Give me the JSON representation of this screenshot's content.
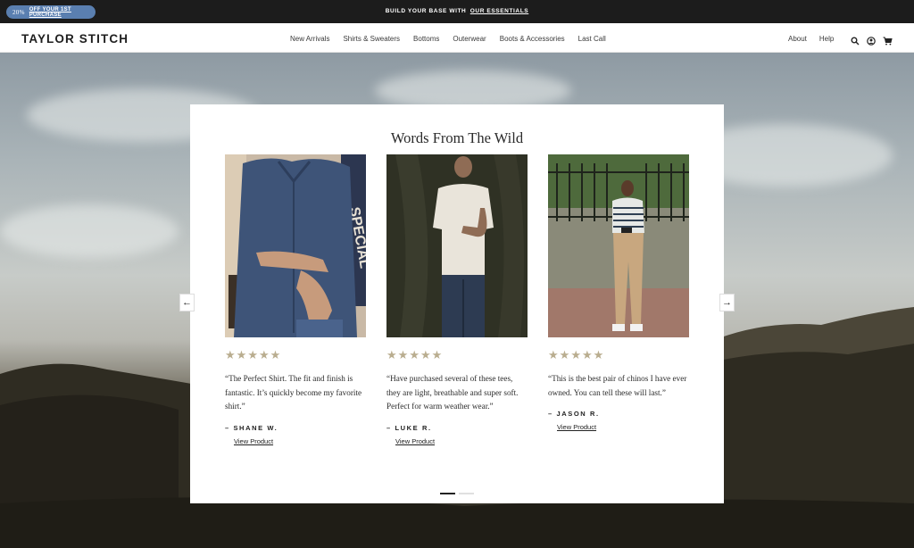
{
  "topbar": {
    "promo_percent": "20%",
    "promo_text": "OFF YOUR 1ST PURCHASE",
    "announcement": "BUILD YOUR BASE WITH",
    "announcement_link": "OUR ESSENTIALS"
  },
  "header": {
    "logo": "TAYLOR STITCH",
    "nav": [
      "New Arrivals",
      "Shirts & Sweaters",
      "Bottoms",
      "Outerwear",
      "Boots & Accessories",
      "Last Call"
    ],
    "utility": [
      "About",
      "Help"
    ],
    "icons": [
      "search-icon",
      "account-icon",
      "cart-icon"
    ]
  },
  "section": {
    "title": "Words From The Wild",
    "reviews": [
      {
        "quote": "“The Perfect Shirt. The fit and finish is fantastic. It’s quickly become my favorite shirt.”",
        "author": "– SHANE W.",
        "link": "View Product",
        "rating": 5
      },
      {
        "quote": "“Have purchased several of these tees, they are light, breathable and super soft. Perfect for warm weather wear.”",
        "author": "– LUKE R.",
        "link": "View Product",
        "rating": 5
      },
      {
        "quote": "“This is the best pair of chinos I have ever owned. You can tell these will last.”",
        "author": "– JASON R.",
        "link": "View Product",
        "rating": 5
      }
    ],
    "prev_arrow": "←",
    "next_arrow": "→",
    "slide_count": 2,
    "active_slide": 1
  },
  "colors": {
    "promo_blue": "#5a7fb0",
    "star_tan": "#b9ad8f",
    "topbar_bg": "#1c1c1c"
  }
}
